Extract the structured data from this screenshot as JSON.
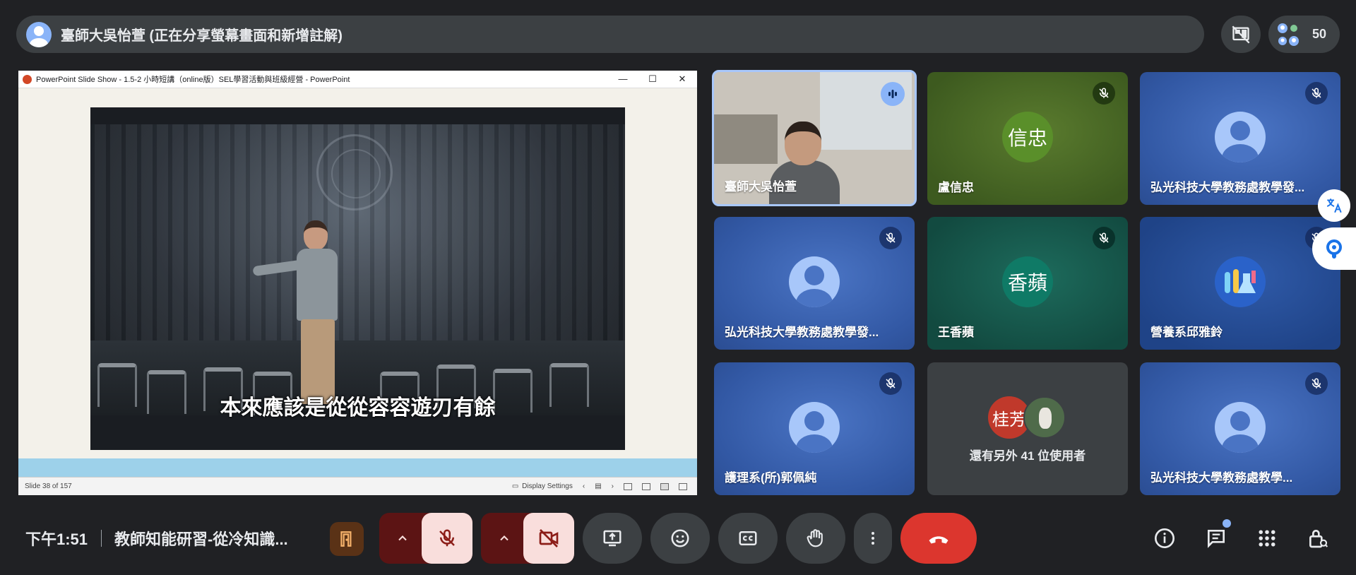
{
  "header": {
    "presenter_text": "臺師大吳怡萱 (正在分享螢幕畫面和新增註解)",
    "people_count": "50"
  },
  "presentation": {
    "window_title": "PowerPoint Slide Show  -  1.5-2 小時短講（online版）SEL學習活動與班級經營 - PowerPoint",
    "window_controls": [
      "—",
      "☐",
      "✕"
    ],
    "subtitle": "本來應該是從從容容遊刃有餘",
    "status_slide": "Slide 38 of 157",
    "status_display_settings": "Display Settings"
  },
  "tiles": [
    {
      "name": "臺師大吳怡萱",
      "type": "video",
      "state": "speaking"
    },
    {
      "name": "盧信忠",
      "type": "initials",
      "initials": "信忠",
      "color": "#5a8f2a",
      "state": "muted"
    },
    {
      "name": "弘光科技大學教務處教學發...",
      "type": "generic",
      "state": "muted"
    },
    {
      "name": "弘光科技大學教務處教學發...",
      "type": "generic",
      "state": "muted"
    },
    {
      "name": "王香蘋",
      "type": "initials",
      "initials": "香蘋",
      "color": "#0f7a66",
      "state": "muted"
    },
    {
      "name": "營養系邱雅鈴",
      "type": "illustration",
      "state": "muted"
    },
    {
      "name": "護理系(所)郭佩純",
      "type": "generic",
      "state": "muted"
    },
    {
      "more_text": "還有另外 41 位使用者",
      "initials": "桂芳",
      "type": "more"
    },
    {
      "name": "弘光科技大學教務處教學...",
      "type": "generic",
      "state": "muted"
    }
  ],
  "footer": {
    "clock": "下午1:51",
    "meeting_title": "教師知能研習-從冷知識..."
  },
  "colors": {
    "background": "#202124",
    "end_call": "#dc362e",
    "mic_off_bg": "#f9dedc",
    "accent": "#8ab4f8"
  },
  "icons": [
    "presenter-avatar-icon",
    "layout-icon",
    "people-icon",
    "translate-icon",
    "assistant-icon",
    "host-controls-icon",
    "mic-off-icon",
    "camera-off-icon",
    "present-icon",
    "emoji-icon",
    "captions-icon",
    "raise-hand-icon",
    "more-options-icon",
    "end-call-icon",
    "info-icon",
    "chat-icon",
    "activities-icon",
    "host-lock-icon"
  ]
}
